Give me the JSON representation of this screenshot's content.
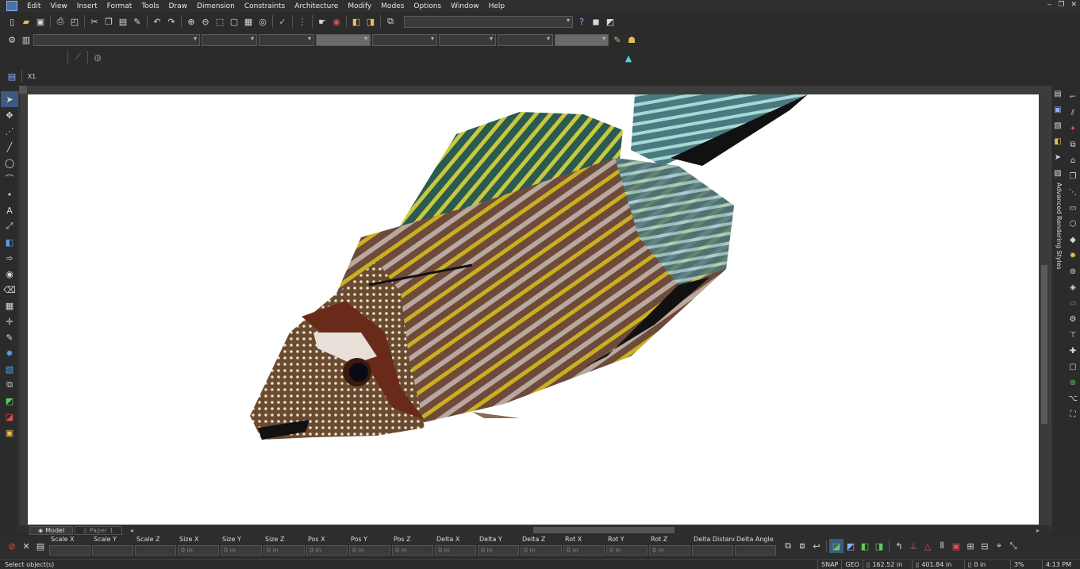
{
  "menu": {
    "items": [
      "Edit",
      "View",
      "Insert",
      "Format",
      "Tools",
      "Draw",
      "Dimension",
      "Constraints",
      "Architecture",
      "Modify",
      "Modes",
      "Options",
      "Window",
      "Help"
    ],
    "window_controls": [
      "‒",
      "❐",
      "✕"
    ]
  },
  "toolbar": {
    "icons_top": [
      "new-file",
      "open",
      "save",
      "print",
      "print-preview",
      "cut",
      "copy",
      "paste",
      "format-painter",
      "undo",
      "redo",
      "zoom-in",
      "zoom-out",
      "zoom-window",
      "zoom-extents",
      "zoom-fit",
      "zoom-realtime",
      "spell-check",
      "snap-grid",
      "render",
      "layers",
      "properties",
      "object-snap"
    ]
  },
  "panels": {
    "right_tab_label": "Advanced Rendering Styles"
  },
  "sheets": {
    "tabs": [
      "Model",
      "Paper 1"
    ]
  },
  "inspector": {
    "fields": [
      {
        "label": "Scale X",
        "value": ""
      },
      {
        "label": "Scale Y",
        "value": ""
      },
      {
        "label": "Scale Z",
        "value": ""
      },
      {
        "label": "Size X",
        "value": "0 in"
      },
      {
        "label": "Size Y",
        "value": "0 in"
      },
      {
        "label": "Size Z",
        "value": "0 in"
      },
      {
        "label": "Pos X",
        "value": "0 in"
      },
      {
        "label": "Pos Y",
        "value": "0 in"
      },
      {
        "label": "Pos Z",
        "value": "0 in"
      },
      {
        "label": "Delta X",
        "value": "0 in"
      },
      {
        "label": "Delta Y",
        "value": "0 in"
      },
      {
        "label": "Delta Z",
        "value": "0 in"
      },
      {
        "label": "Rot X",
        "value": "0 in"
      },
      {
        "label": "Rot Y",
        "value": "0 in"
      },
      {
        "label": "Rot Z",
        "value": "0 in"
      },
      {
        "label": "Delta Distance",
        "value": ""
      },
      {
        "label": "Delta Angle",
        "value": ""
      }
    ]
  },
  "status": {
    "message": "Select object(s)",
    "snap": "SNAP",
    "geo": "GEO",
    "x_coord": "162.52 in",
    "y_coord": "401.84 in",
    "z_coord": "0 in",
    "zoom": "3%",
    "time": "4:13 PM"
  },
  "colors": {
    "accent": "#4a6ea8",
    "viewport_bg": "#ffffff",
    "ui_bg": "#2b2b2b"
  }
}
